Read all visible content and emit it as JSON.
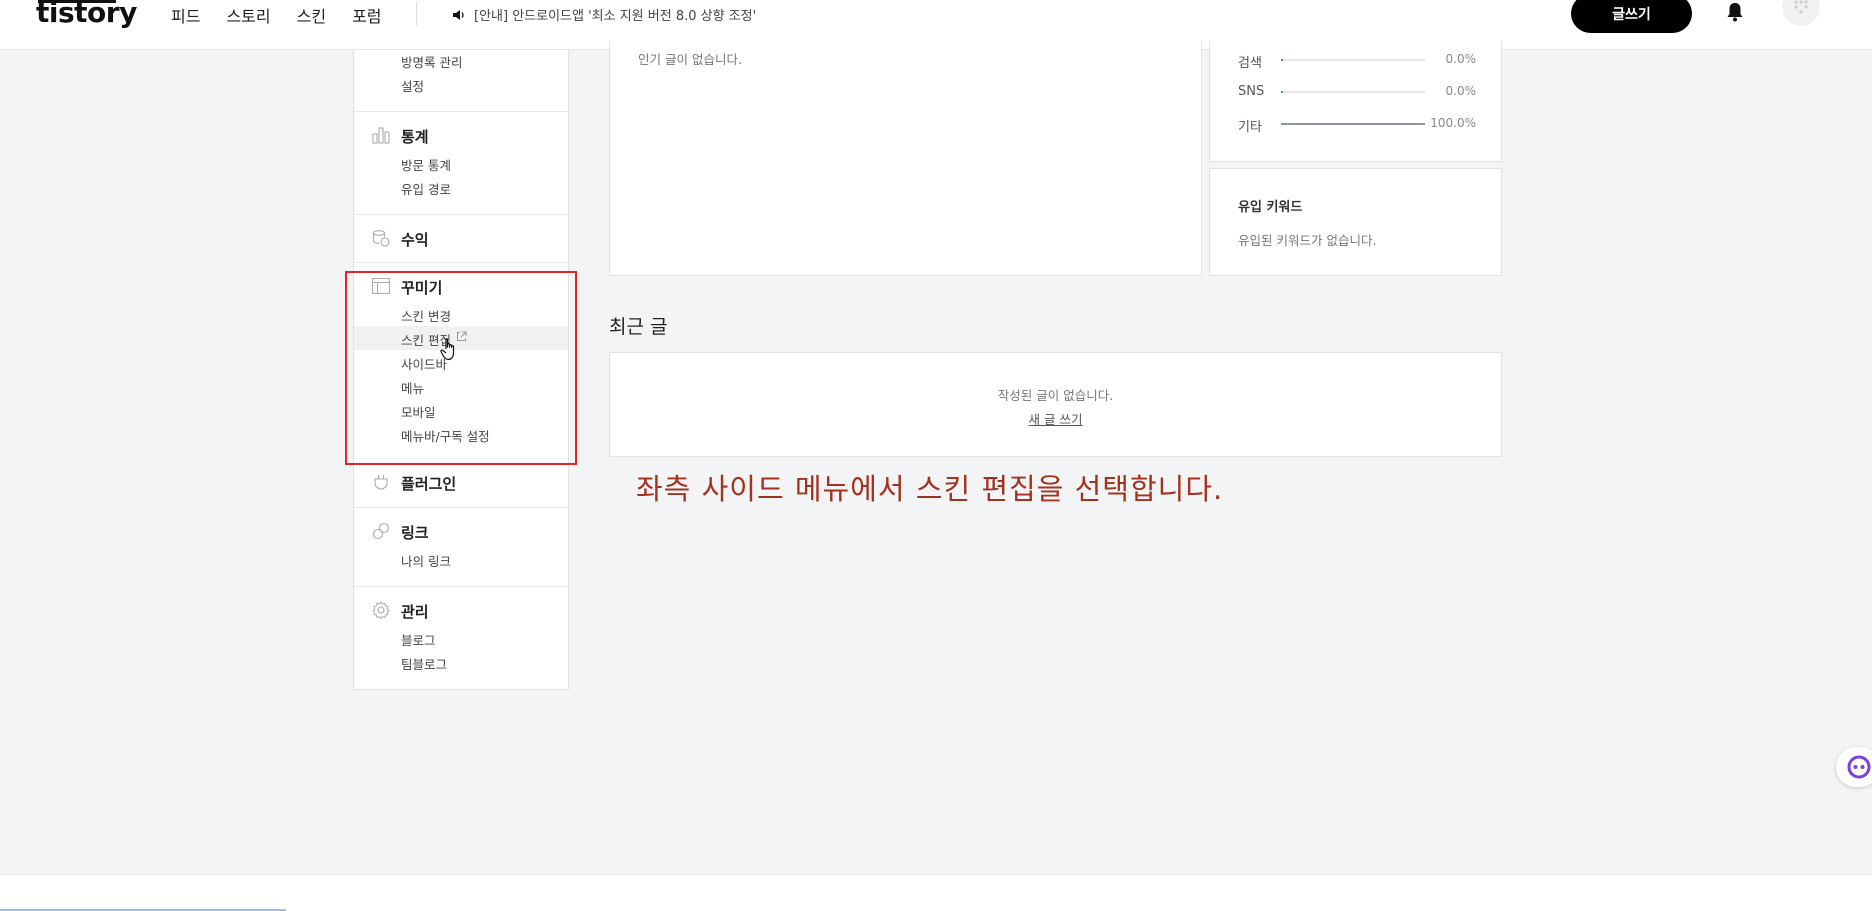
{
  "header": {
    "logo": "tistory",
    "nav": [
      "피드",
      "스토리",
      "스킨",
      "포럼"
    ],
    "notice": "[안내] 안드로이드앱 '최소 지원 버전 8.0 상향 조정'",
    "write_label": "글쓰기"
  },
  "sidebar": {
    "top_items": [
      "방명록 관리",
      "설정"
    ],
    "stats": {
      "title": "통계",
      "items": [
        "방문 통계",
        "유입 경로"
      ]
    },
    "revenue": {
      "title": "수익"
    },
    "decorate": {
      "title": "꾸미기",
      "items": [
        "스킨 변경",
        "스킨 편집",
        "사이드바",
        "메뉴",
        "모바일",
        "메뉴바/구독 설정"
      ]
    },
    "plugin": {
      "title": "플러그인"
    },
    "link": {
      "title": "링크",
      "items": [
        "나의 링크"
      ]
    },
    "manage": {
      "title": "관리",
      "items": [
        "블로그",
        "팀블로그"
      ]
    }
  },
  "popular": {
    "empty": "인기 글이 없습니다."
  },
  "inflow": [
    {
      "label": "검색",
      "value": "0.0%",
      "percent": 0
    },
    {
      "label": "SNS",
      "value": "0.0%",
      "percent": 0
    },
    {
      "label": "기타",
      "value": "100.0%",
      "percent": 100
    }
  ],
  "keywords": {
    "title": "유입 키워드",
    "empty": "유입된 키워드가 없습니다."
  },
  "recent": {
    "title": "최근 글",
    "empty": "작성된 글이 없습니다.",
    "new_post": "새 글 쓰기"
  },
  "caption": "좌측 사이드 메뉴에서 스킨 편집을 선택합니다.",
  "colors": {
    "highlight_box": "#e0262a",
    "caption": "#a4321e"
  }
}
